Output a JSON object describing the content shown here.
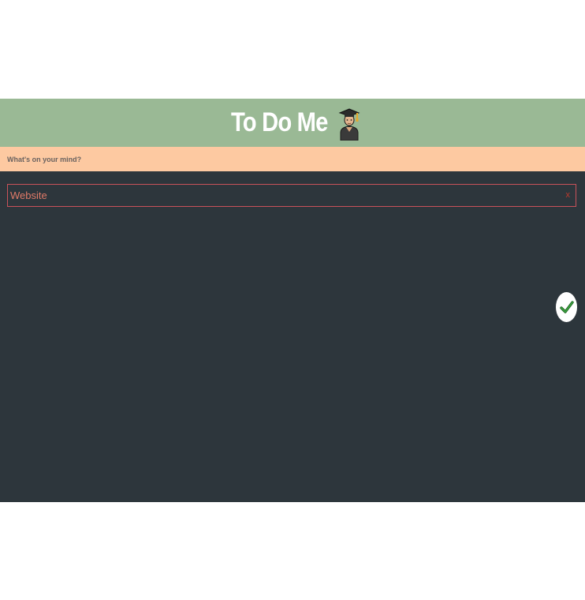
{
  "header": {
    "title": "To Do Me",
    "icon": "graduate-emoji-icon"
  },
  "input": {
    "placeholder": "What's on your mind?",
    "value": ""
  },
  "todos": [
    {
      "text": "Website",
      "delete_label": "x"
    }
  ],
  "actions": {
    "done_icon": "checkmark-icon"
  },
  "colors": {
    "header_bg": "#9ab995",
    "input_bg": "#fdc9a1",
    "app_bg": "#2d363c",
    "todo_border": "#c9525a",
    "todo_text": "#e07a68",
    "delete": "#c0392b",
    "check": "#2e7d32"
  }
}
